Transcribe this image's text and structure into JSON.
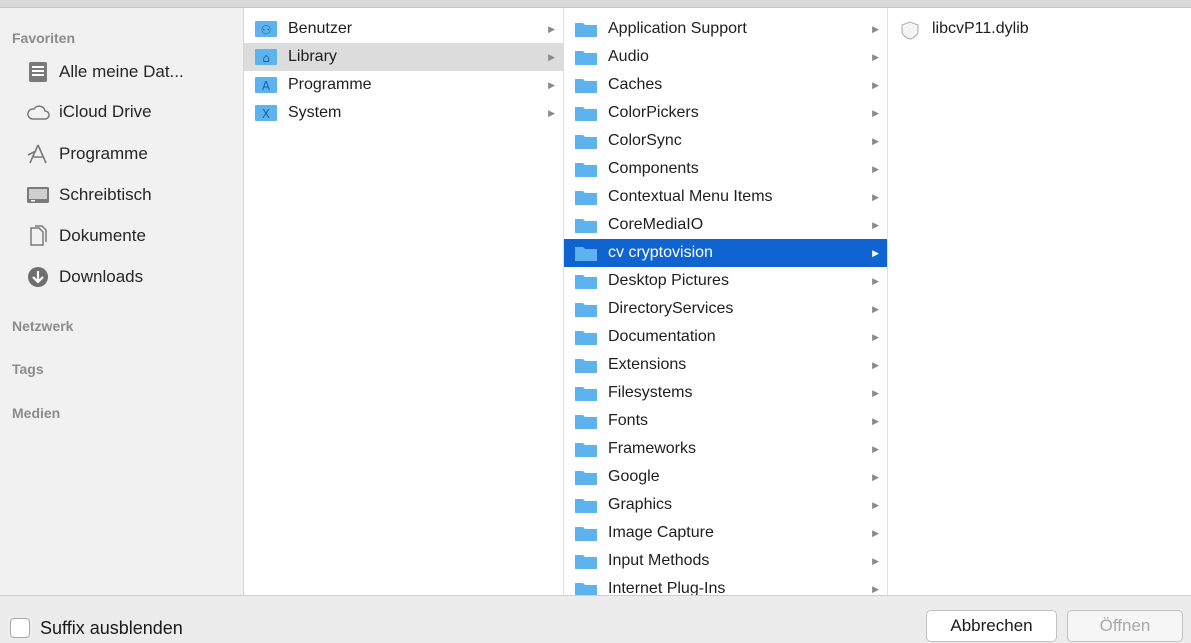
{
  "sidebar": {
    "sections": [
      {
        "label": "Favoriten"
      },
      {
        "label": "Netzwerk"
      },
      {
        "label": "Tags"
      },
      {
        "label": "Medien"
      }
    ],
    "favorites": [
      {
        "label": "Alle meine Dat...",
        "icon": "all-files-icon"
      },
      {
        "label": "iCloud Drive",
        "icon": "cloud-icon"
      },
      {
        "label": "Programme",
        "icon": "applications-icon"
      },
      {
        "label": "Schreibtisch",
        "icon": "desktop-icon"
      },
      {
        "label": "Dokumente",
        "icon": "documents-icon"
      },
      {
        "label": "Downloads",
        "icon": "downloads-icon"
      }
    ]
  },
  "columns": {
    "root": [
      {
        "label": "Benutzer",
        "icon": "users-folder-icon"
      },
      {
        "label": "Library",
        "icon": "library-folder-icon",
        "selected": "inactive"
      },
      {
        "label": "Programme",
        "icon": "applications-folder-icon"
      },
      {
        "label": "System",
        "icon": "system-folder-icon"
      }
    ],
    "library": [
      {
        "label": "Application Support"
      },
      {
        "label": "Audio"
      },
      {
        "label": "Caches"
      },
      {
        "label": "ColorPickers"
      },
      {
        "label": "ColorSync"
      },
      {
        "label": "Components"
      },
      {
        "label": "Contextual Menu Items"
      },
      {
        "label": "CoreMediaIO"
      },
      {
        "label": "cv cryptovision",
        "selected": "active"
      },
      {
        "label": "Desktop Pictures"
      },
      {
        "label": "DirectoryServices"
      },
      {
        "label": "Documentation"
      },
      {
        "label": "Extensions"
      },
      {
        "label": "Filesystems"
      },
      {
        "label": "Fonts"
      },
      {
        "label": "Frameworks"
      },
      {
        "label": "Google"
      },
      {
        "label": "Graphics"
      },
      {
        "label": "Image Capture"
      },
      {
        "label": "Input Methods"
      },
      {
        "label": "Internet Plug-Ins"
      }
    ],
    "cryptovision": [
      {
        "label": "libcvP11.dylib",
        "icon": "dylib-file-icon"
      }
    ]
  },
  "footer": {
    "checkbox_label": "Suffix ausblenden",
    "cancel_label": "Abbrechen",
    "open_label": "Öffnen"
  },
  "colors": {
    "selection_active": "#0f64d2",
    "selection_inactive": "#dcdcdc",
    "folder": "#5db3ee"
  }
}
